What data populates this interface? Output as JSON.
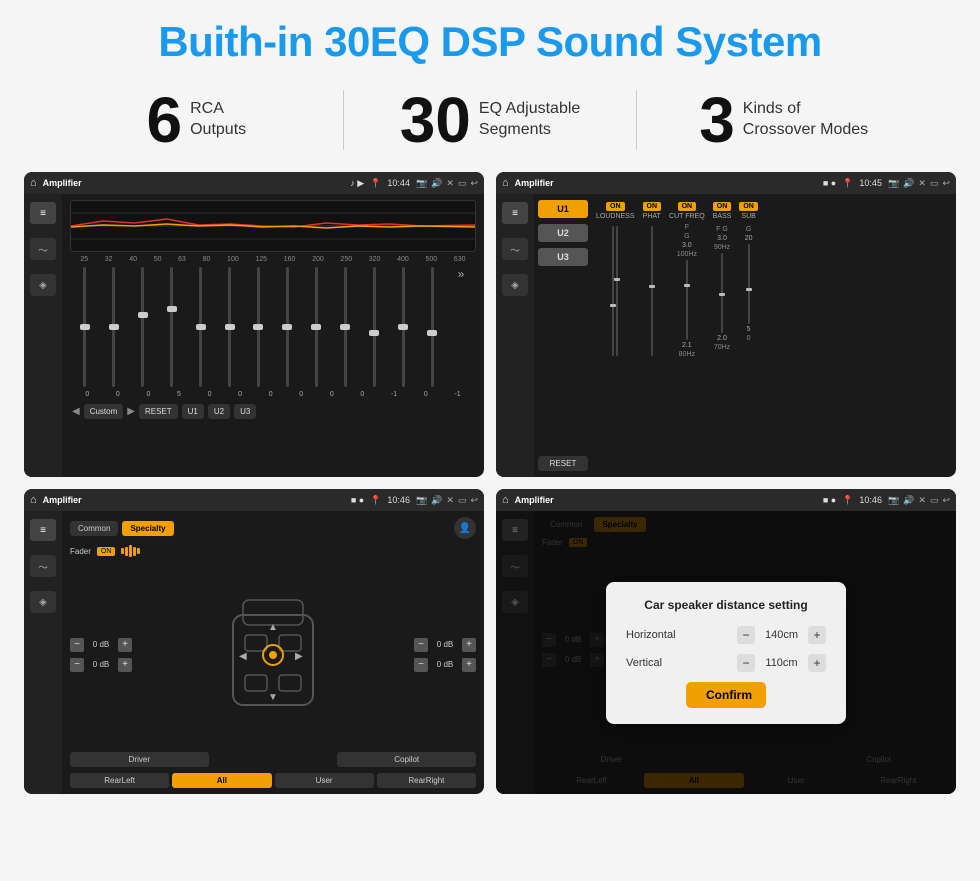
{
  "page": {
    "title": "Buith-in 30EQ DSP Sound System"
  },
  "stats": [
    {
      "number": "6",
      "text": "RCA\nOutputs"
    },
    {
      "number": "30",
      "text": "EQ Adjustable\nSegments"
    },
    {
      "number": "3",
      "text": "Kinds of\nCrossover Modes"
    }
  ],
  "screens": {
    "screen1": {
      "topbar": {
        "title": "Amplifier",
        "time": "10:44"
      },
      "eq_labels": [
        "25",
        "32",
        "40",
        "50",
        "63",
        "80",
        "100",
        "125",
        "160",
        "200",
        "250",
        "320",
        "400",
        "500",
        "630"
      ],
      "eq_values": [
        "0",
        "0",
        "0",
        "5",
        "0",
        "0",
        "0",
        "0",
        "0",
        "0",
        "-1",
        "0",
        "-1"
      ],
      "buttons": [
        "Custom",
        "RESET",
        "U1",
        "U2",
        "U3"
      ]
    },
    "screen2": {
      "topbar": {
        "title": "Amplifier",
        "time": "10:45"
      },
      "presets": [
        "U1",
        "U2",
        "U3"
      ],
      "controls": [
        "LOUDNESS",
        "PHAT",
        "CUT FREQ",
        "BASS",
        "SUB"
      ],
      "reset_label": "RESET"
    },
    "screen3": {
      "topbar": {
        "title": "Amplifier",
        "time": "10:46"
      },
      "tabs": [
        "Common",
        "Specialty"
      ],
      "fader_label": "Fader",
      "fader_on": "ON",
      "db_values": [
        "0 dB",
        "0 dB",
        "0 dB",
        "0 dB"
      ],
      "bottom_buttons": [
        "Driver",
        "All",
        "User",
        "RearLeft",
        "Copilot",
        "RearRight"
      ]
    },
    "screen4": {
      "topbar": {
        "title": "Amplifier",
        "time": "10:46"
      },
      "tabs": [
        "Common",
        "Specialty"
      ],
      "dialog": {
        "title": "Car speaker distance setting",
        "fields": [
          {
            "label": "Horizontal",
            "value": "140cm"
          },
          {
            "label": "Vertical",
            "value": "110cm"
          }
        ],
        "confirm_label": "Confirm"
      },
      "db_values": [
        "0 dB",
        "0 dB"
      ],
      "bottom_buttons": [
        "Driver",
        "All",
        "User",
        "RearLeft",
        "Copilot",
        "RearRight"
      ]
    }
  }
}
